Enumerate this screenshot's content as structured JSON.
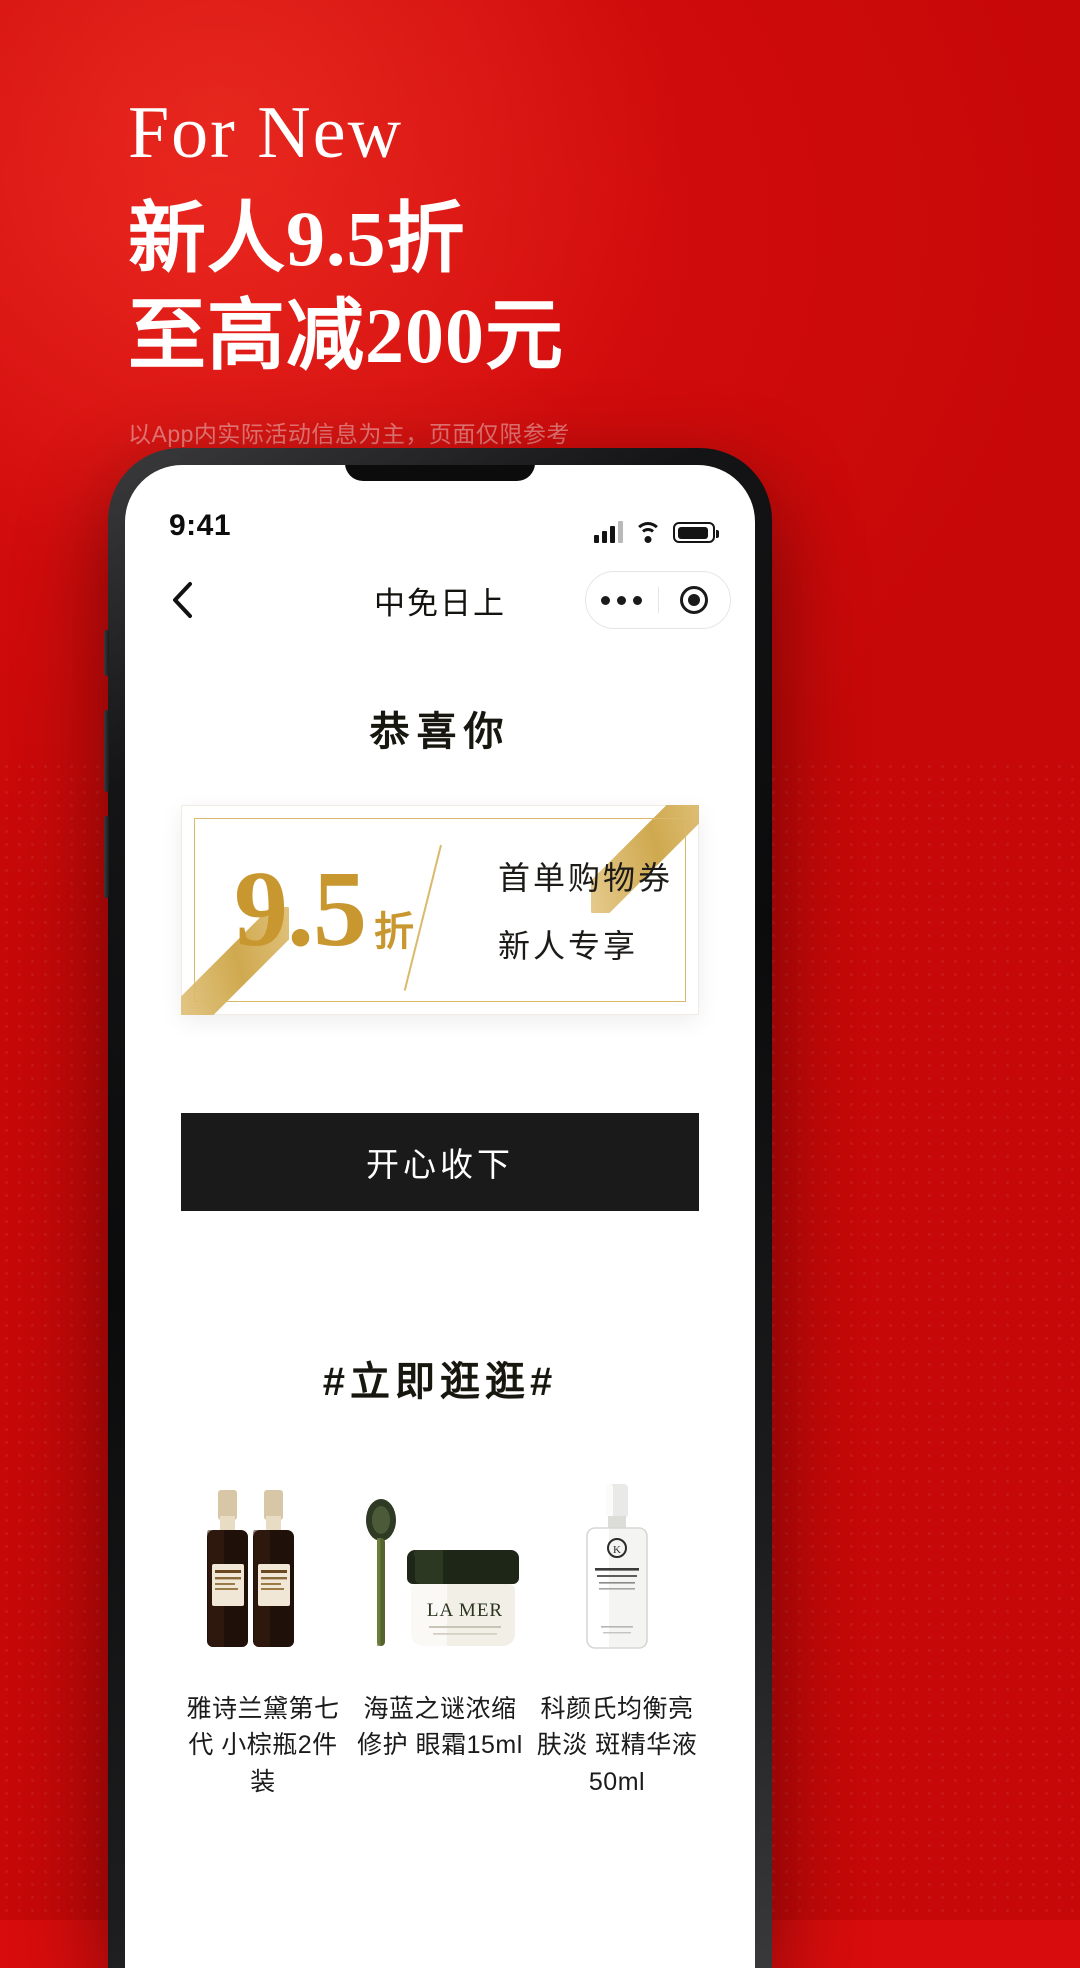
{
  "poster": {
    "headline_en": "For New",
    "headline_cn_line1": "新人9.5折",
    "headline_cn_line2": "至高减200元",
    "disclaimer": "以App内实际活动信息为主，页面仅限参考",
    "background_color": "#d80c0c"
  },
  "phone": {
    "status_bar": {
      "time": "9:41",
      "signal_icon": "cellular-signal-icon",
      "wifi_icon": "wifi-icon",
      "battery_icon": "battery-icon"
    },
    "nav": {
      "back_icon": "back-chevron-icon",
      "title": "中免日上",
      "menu_icon": "more-dots-icon",
      "close_icon": "target-circle-icon"
    },
    "page": {
      "congrats_title": "恭喜你",
      "coupon": {
        "amount": "9.5",
        "unit": "折",
        "line1": "首单购物券",
        "line2": "新人专享",
        "accent_color": "#c9972f",
        "border_color": "#d9b96a"
      },
      "cta_label": "开心收下",
      "section_title": "#立即逛逛#",
      "products": [
        {
          "name": "雅诗兰黛第七代\n小棕瓶2件装",
          "icon": "serum-bottle-pair-icon"
        },
        {
          "name": "海蓝之谜浓缩修护\n眼霜15ml",
          "icon": "eye-cream-jar-icon"
        },
        {
          "name": "科颜氏均衡亮肤淡\n斑精华液50ml",
          "icon": "dropper-serum-icon"
        }
      ]
    }
  }
}
